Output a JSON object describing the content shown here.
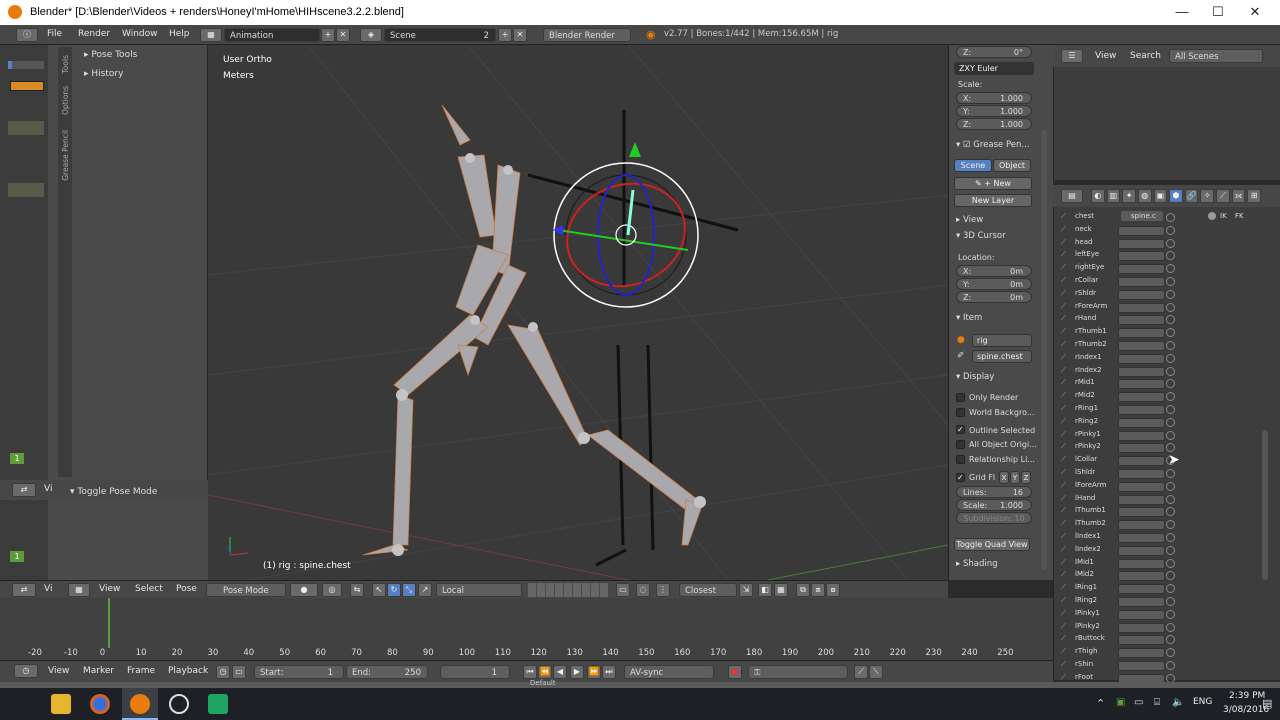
{
  "window": {
    "title": "Blender* [D:\\Blender\\Videos + renders\\HoneyI'mHome\\HIHscene3.2.2.blend]",
    "minimize": "—",
    "maximize": "☐",
    "close": "✕"
  },
  "info_header": {
    "menus": [
      "File",
      "Render",
      "Window",
      "Help"
    ],
    "screen_layout": "Animation",
    "scene": "Scene",
    "scene_users": "2",
    "render_engine": "Blender Render",
    "stats": "v2.77 | Bones:1/442 | Mem:156.65M | rig"
  },
  "tool_shelf": {
    "tabs": [
      "Tools",
      "Options",
      "Grease Pencil"
    ],
    "panels": [
      "Pose Tools",
      "History"
    ],
    "operator_panel": "Toggle Pose Mode",
    "layer_badges": [
      "1",
      "1"
    ]
  },
  "viewport": {
    "view_name": "User Ortho",
    "units": "Meters",
    "selection_info": "(1) rig : spine.chest"
  },
  "viewport_header": {
    "menus": [
      "View",
      "Select",
      "Pose"
    ],
    "mode": "Pose Mode",
    "transform_orientation": "Local",
    "snap_target": "Closest"
  },
  "properties": {
    "rotation_z_label": "Z:",
    "rotation_z_value": "0°",
    "rotation_mode": "ZXY Euler",
    "scale_label": "Scale:",
    "scale": [
      {
        "axis": "X:",
        "value": "1.000"
      },
      {
        "axis": "Y:",
        "value": "1.000"
      },
      {
        "axis": "Z:",
        "value": "1.000"
      }
    ],
    "grease_pencil": "Grease Pen...",
    "gp_scene": "Scene",
    "gp_object": "Object",
    "gp_new": "New",
    "gp_new_layer": "New Layer",
    "view_section": "View",
    "cursor_section": "3D Cursor",
    "location_label": "Location:",
    "location": [
      {
        "axis": "X:",
        "value": "0m"
      },
      {
        "axis": "Y:",
        "value": "0m"
      },
      {
        "axis": "Z:",
        "value": "0m"
      }
    ],
    "item_section": "Item",
    "item_object": "rig",
    "item_bone": "spine.chest",
    "display_section": "Display",
    "display_options": [
      {
        "label": "Only Render",
        "checked": false
      },
      {
        "label": "World Backgro...",
        "checked": false
      },
      {
        "label": "Outline Selected",
        "checked": true
      },
      {
        "label": "All Object Origi...",
        "checked": false
      },
      {
        "label": "Relationship Li...",
        "checked": false
      }
    ],
    "grid_floor": "Grid Fl",
    "grid_axes": [
      "X",
      "Y",
      "Z"
    ],
    "lines_label": "Lines:",
    "lines_value": "16",
    "grid_scale_label": "Scale:",
    "grid_scale_value": "1.000",
    "subdivision": "Subdivision: 10",
    "toggle_quad": "Toggle Quad View",
    "shading_section": "Shading"
  },
  "outliner": {
    "menus": [
      "View",
      "Search"
    ],
    "filter": "All Scenes"
  },
  "bone_list": {
    "first_row_extra": "spine.c",
    "ik_fk": [
      "IK",
      "FK"
    ],
    "bones": [
      "chest",
      "neck",
      "head",
      "leftEye",
      "rightEye",
      "rCollar",
      "rShldr",
      "rForeArm",
      "rHand",
      "rThumb1",
      "rThumb2",
      "rIndex1",
      "rIndex2",
      "rMid1",
      "rMid2",
      "rRing1",
      "rRing2",
      "rPinky1",
      "rPinky2",
      "lCollar",
      "lShldr",
      "lForeArm",
      "lHand",
      "lThumb1",
      "lThumb2",
      "lIndex1",
      "lIndex2",
      "lMid1",
      "lMid2",
      "lRing1",
      "lRing2",
      "lPinky1",
      "lPinky2",
      "rButtock",
      "rThigh",
      "rShin",
      "rFoot"
    ]
  },
  "timeline": {
    "ticks": [
      "-20",
      "-10",
      "0",
      "10",
      "20",
      "30",
      "40",
      "50",
      "60",
      "70",
      "80",
      "90",
      "100",
      "110",
      "120",
      "130",
      "140",
      "150",
      "160",
      "170",
      "180",
      "190",
      "200",
      "210",
      "220",
      "230",
      "240",
      "250"
    ],
    "menus": [
      "View",
      "Marker",
      "Frame",
      "Playback"
    ],
    "start_label": "Start:",
    "start_value": "1",
    "end_label": "End:",
    "end_value": "250",
    "current_frame": "1",
    "sync": "AV-sync",
    "status_text": "Default"
  },
  "taskbar": {
    "language": "ENG",
    "time": "2:39 PM",
    "date": "3/08/2016"
  },
  "colors": {
    "accent_orange": "#e87d0d",
    "selection_blue": "#5680c2",
    "viewport_bg": "#393939",
    "panel_bg": "#4a4a4a"
  }
}
